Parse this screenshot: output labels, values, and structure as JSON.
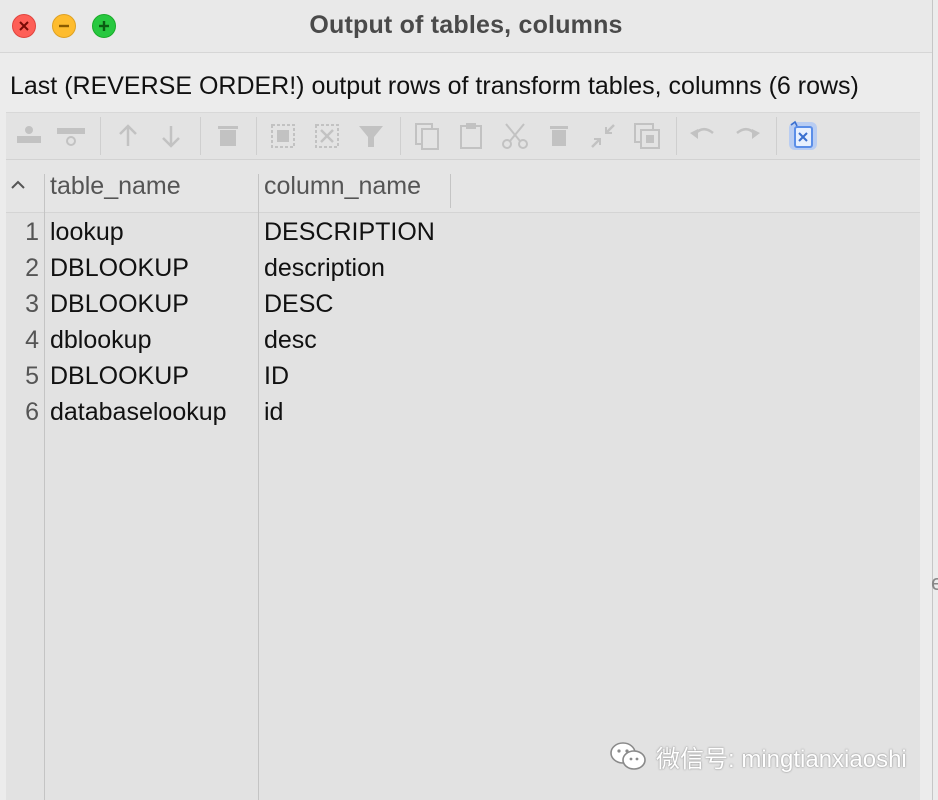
{
  "window": {
    "title": "Output of tables, columns",
    "controls": {
      "close": "close-button",
      "minimize": "minimize-button",
      "maximize": "maximize-button"
    }
  },
  "info_line": "Last (REVERSE ORDER!) output rows of transform tables, columns (6 rows)",
  "toolbar": {
    "icons": [
      "insert-row-icon",
      "delete-row-icon",
      "move-up-icon",
      "move-down-icon",
      "trash-icon",
      "select-all-icon",
      "clear-selection-icon",
      "filter-icon",
      "copy-icon",
      "paste-icon",
      "cut-icon",
      "delete-icon",
      "shrink-icon",
      "duplicate-icon",
      "undo-icon",
      "redo-icon",
      "export-excel-icon"
    ]
  },
  "table": {
    "sort_indicator": "^",
    "columns": [
      "table_name",
      "column_name"
    ],
    "rows": [
      {
        "num": "1",
        "table_name": "lookup",
        "column_name": "DESCRIPTION"
      },
      {
        "num": "2",
        "table_name": "DBLOOKUP",
        "column_name": "description"
      },
      {
        "num": "3",
        "table_name": "DBLOOKUP",
        "column_name": "DESC"
      },
      {
        "num": "4",
        "table_name": "dblookup",
        "column_name": "desc"
      },
      {
        "num": "5",
        "table_name": "DBLOOKUP",
        "column_name": "ID"
      },
      {
        "num": "6",
        "table_name": "databaselookup",
        "column_name": "id"
      }
    ]
  },
  "watermark": {
    "text": "微信号: mingtianxiaoshi",
    "icon": "wechat-icon"
  },
  "edge_glyph": "e",
  "colors": {
    "close": "#fe5f57",
    "minimize": "#febc2e",
    "maximize": "#28c840",
    "excel_accent": "#5b8ee8"
  }
}
